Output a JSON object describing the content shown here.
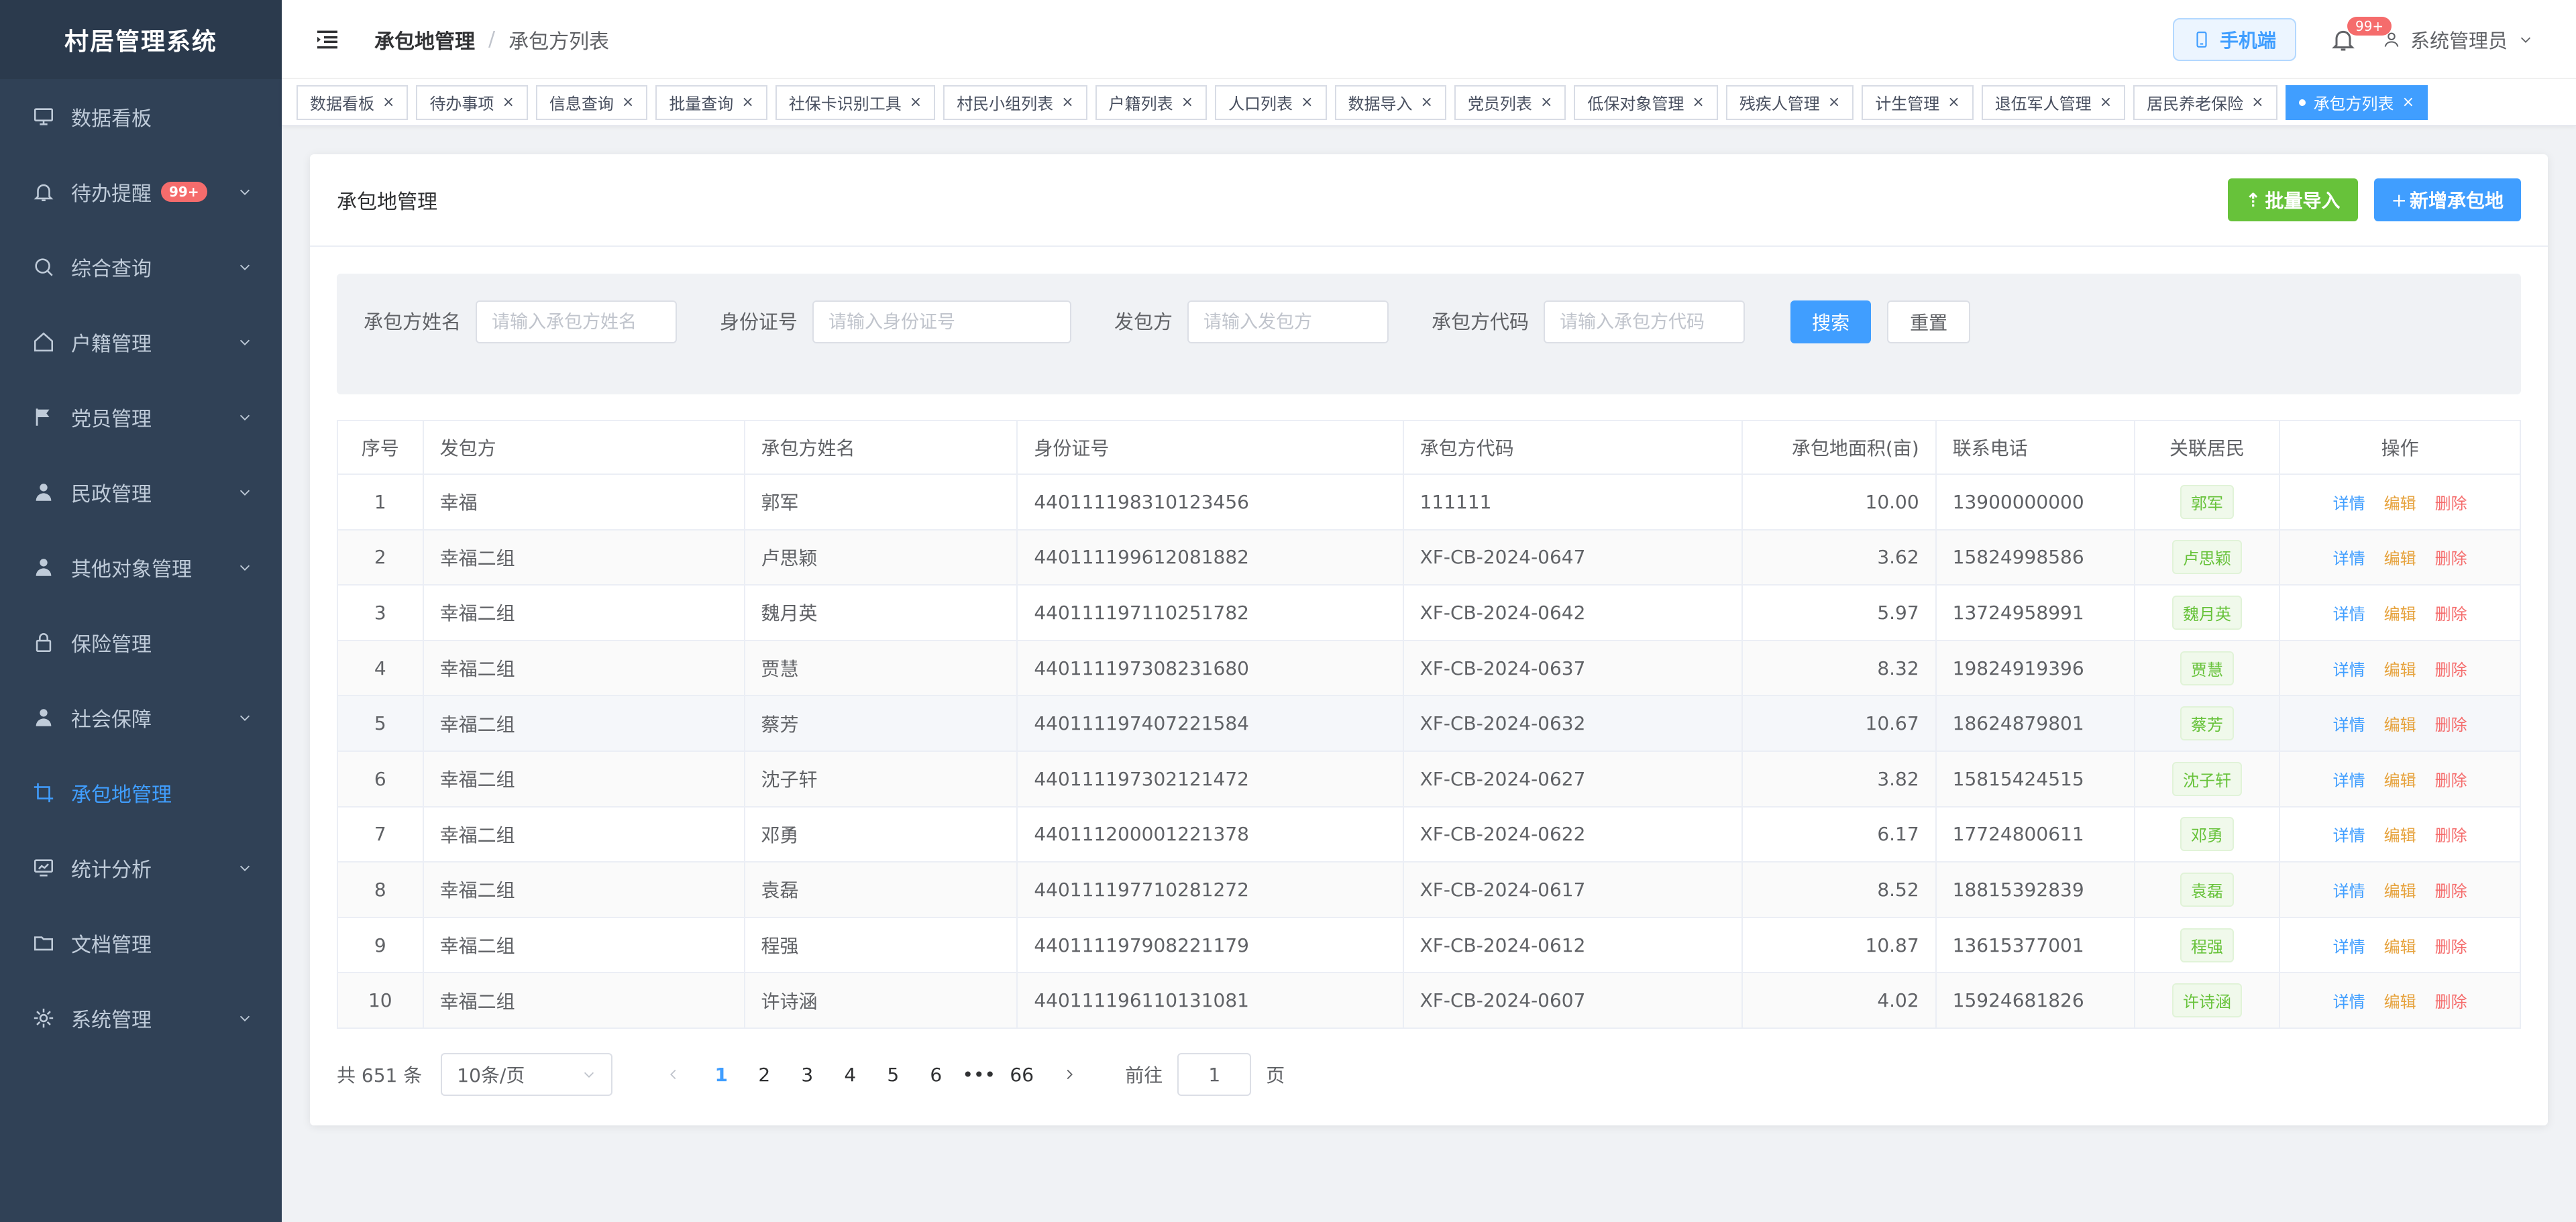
{
  "app": {
    "title": "村居管理系统"
  },
  "sidebar": {
    "items": [
      {
        "label": "数据看板",
        "icon": "monitor-icon",
        "has_children": false,
        "badge": "",
        "active": false
      },
      {
        "label": "待办提醒",
        "icon": "bell-icon",
        "has_children": true,
        "badge": "99+",
        "active": false
      },
      {
        "label": "综合查询",
        "icon": "search-icon",
        "has_children": true,
        "badge": "",
        "active": false
      },
      {
        "label": "户籍管理",
        "icon": "home-icon",
        "has_children": true,
        "badge": "",
        "active": false
      },
      {
        "label": "党员管理",
        "icon": "flag-icon",
        "has_children": true,
        "badge": "",
        "active": false
      },
      {
        "label": "民政管理",
        "icon": "user-icon",
        "has_children": true,
        "badge": "",
        "active": false
      },
      {
        "label": "其他对象管理",
        "icon": "user-icon",
        "has_children": true,
        "badge": "",
        "active": false
      },
      {
        "label": "保险管理",
        "icon": "lock-icon",
        "has_children": false,
        "badge": "",
        "active": false
      },
      {
        "label": "社会保障",
        "icon": "user-icon",
        "has_children": true,
        "badge": "",
        "active": false
      },
      {
        "label": "承包地管理",
        "icon": "crop-icon",
        "has_children": false,
        "badge": "",
        "active": true
      },
      {
        "label": "统计分析",
        "icon": "chart-monitor-icon",
        "has_children": true,
        "badge": "",
        "active": false
      },
      {
        "label": "文档管理",
        "icon": "folder-icon",
        "has_children": false,
        "badge": "",
        "active": false
      },
      {
        "label": "系统管理",
        "icon": "gear-icon",
        "has_children": true,
        "badge": "",
        "active": false
      }
    ]
  },
  "header": {
    "breadcrumb_parent": "承包地管理",
    "breadcrumb_current": "承包方列表",
    "mobile_label": "手机端",
    "notification_badge": "99+",
    "user_name": "系统管理员"
  },
  "tags": [
    {
      "label": "数据看板",
      "active": false
    },
    {
      "label": "待办事项",
      "active": false
    },
    {
      "label": "信息查询",
      "active": false
    },
    {
      "label": "批量查询",
      "active": false
    },
    {
      "label": "社保卡识别工具",
      "active": false
    },
    {
      "label": "村民小组列表",
      "active": false
    },
    {
      "label": "户籍列表",
      "active": false
    },
    {
      "label": "人口列表",
      "active": false
    },
    {
      "label": "数据导入",
      "active": false
    },
    {
      "label": "党员列表",
      "active": false
    },
    {
      "label": "低保对象管理",
      "active": false
    },
    {
      "label": "残疾人管理",
      "active": false
    },
    {
      "label": "计生管理",
      "active": false
    },
    {
      "label": "退伍军人管理",
      "active": false
    },
    {
      "label": "居民养老保险",
      "active": false
    },
    {
      "label": "承包方列表",
      "active": true
    }
  ],
  "card": {
    "title": "承包地管理",
    "import_label": "批量导入",
    "add_label": "新增承包地"
  },
  "search": {
    "name_label": "承包方姓名",
    "name_placeholder": "请输入承包方姓名",
    "id_label": "身份证号",
    "id_placeholder": "请输入身份证号",
    "issuer_label": "发包方",
    "issuer_placeholder": "请输入发包方",
    "code_label": "承包方代码",
    "code_placeholder": "请输入承包方代码",
    "search_label": "搜索",
    "reset_label": "重置"
  },
  "table": {
    "columns": [
      "序号",
      "发包方",
      "承包方姓名",
      "身份证号",
      "承包方代码",
      "承包地面积(亩)",
      "联系电话",
      "关联居民",
      "操作"
    ],
    "action_labels": {
      "detail": "详情",
      "edit": "编辑",
      "delete": "删除"
    },
    "rows": [
      {
        "no": "1",
        "issuer": "幸福",
        "name": "郭军",
        "id": "440111198310123456",
        "code": "111111",
        "area": "10.00",
        "phone": "13900000000",
        "resident": "郭军"
      },
      {
        "no": "2",
        "issuer": "幸福二组",
        "name": "卢思颖",
        "id": "440111199612081882",
        "code": "XF-CB-2024-0647",
        "area": "3.62",
        "phone": "15824998586",
        "resident": "卢思颖"
      },
      {
        "no": "3",
        "issuer": "幸福二组",
        "name": "魏月英",
        "id": "440111197110251782",
        "code": "XF-CB-2024-0642",
        "area": "5.97",
        "phone": "13724958991",
        "resident": "魏月英"
      },
      {
        "no": "4",
        "issuer": "幸福二组",
        "name": "贾慧",
        "id": "440111197308231680",
        "code": "XF-CB-2024-0637",
        "area": "8.32",
        "phone": "19824919396",
        "resident": "贾慧"
      },
      {
        "no": "5",
        "issuer": "幸福二组",
        "name": "蔡芳",
        "id": "440111197407221584",
        "code": "XF-CB-2024-0632",
        "area": "10.67",
        "phone": "18624879801",
        "resident": "蔡芳"
      },
      {
        "no": "6",
        "issuer": "幸福二组",
        "name": "沈子轩",
        "id": "440111197302121472",
        "code": "XF-CB-2024-0627",
        "area": "3.82",
        "phone": "15815424515",
        "resident": "沈子轩"
      },
      {
        "no": "7",
        "issuer": "幸福二组",
        "name": "邓勇",
        "id": "440111200001221378",
        "code": "XF-CB-2024-0622",
        "area": "6.17",
        "phone": "17724800611",
        "resident": "邓勇"
      },
      {
        "no": "8",
        "issuer": "幸福二组",
        "name": "袁磊",
        "id": "440111197710281272",
        "code": "XF-CB-2024-0617",
        "area": "8.52",
        "phone": "18815392839",
        "resident": "袁磊"
      },
      {
        "no": "9",
        "issuer": "幸福二组",
        "name": "程强",
        "id": "440111197908221179",
        "code": "XF-CB-2024-0612",
        "area": "10.87",
        "phone": "13615377001",
        "resident": "程强"
      },
      {
        "no": "10",
        "issuer": "幸福二组",
        "name": "许诗涵",
        "id": "440111196110131081",
        "code": "XF-CB-2024-0607",
        "area": "4.02",
        "phone": "15924681826",
        "resident": "许诗涵"
      }
    ]
  },
  "pagination": {
    "total_text": "共 651 条",
    "page_size": "10条/页",
    "pages": [
      "1",
      "2",
      "3",
      "4",
      "5",
      "6",
      "•••",
      "66"
    ],
    "current_page": "1",
    "goto_prefix": "前往",
    "goto_value": "1",
    "goto_suffix": "页"
  },
  "colors": {
    "sidebar_bg": "#304156",
    "accent": "#409eff",
    "success": "#67c23a",
    "warning": "#e6a23c",
    "danger": "#f56c6c"
  }
}
